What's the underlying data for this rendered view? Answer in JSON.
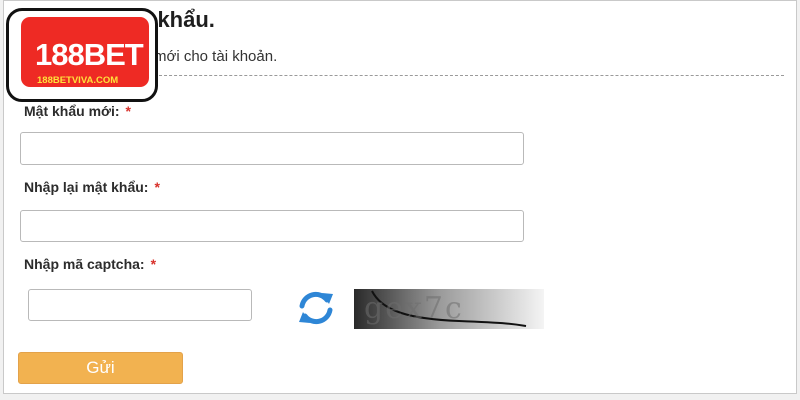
{
  "logo": {
    "text": "188BET",
    "subtext": "188BETVIVA.COM"
  },
  "header": {
    "title": "t khẩu.",
    "subtitle": "mới cho tài khoản."
  },
  "form": {
    "new_password_label": "Mật khẩu mới:",
    "confirm_password_label": "Nhập lại mật khẩu:",
    "captcha_label": "Nhập mã captcha:",
    "required_mark": "*",
    "new_password_value": "",
    "confirm_password_value": "",
    "captcha_value": "",
    "captcha_image_text": "gex7c",
    "submit_label": "Gửi"
  },
  "colors": {
    "required": "#d8312b",
    "submit_button": "#f2b250",
    "refresh_icon": "#2e86d6",
    "logo_red": "#ee2a24"
  },
  "icons": {
    "refresh": "refresh-icon"
  }
}
